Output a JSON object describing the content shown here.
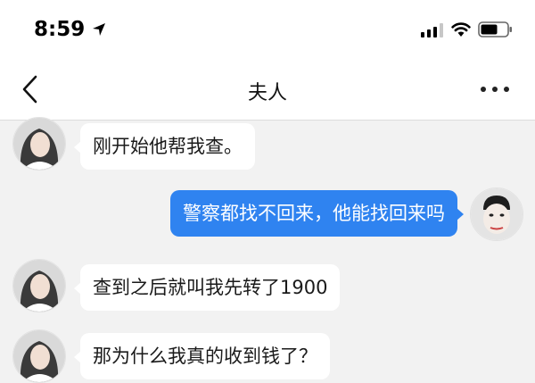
{
  "status_bar": {
    "time": "8:59",
    "icons": [
      "location-arrow-icon",
      "signal-icon",
      "wifi-icon",
      "battery-icon"
    ]
  },
  "nav": {
    "title": "夫人",
    "back_icon": "chevron-left-icon",
    "more_icon": "more-dots-icon"
  },
  "colors": {
    "outgoing_bubble": "#2f83f0",
    "incoming_bubble": "#ffffff",
    "chat_background": "#f2f2f2"
  },
  "messages": [
    {
      "direction": "incoming",
      "text": "刚开始他帮我查。"
    },
    {
      "direction": "outgoing",
      "text": "警察都找不回来，他能找回来吗"
    },
    {
      "direction": "incoming",
      "text": "查到之后就叫我先转了1900"
    },
    {
      "direction": "incoming",
      "text": "那为什么我真的收到钱了？"
    }
  ]
}
